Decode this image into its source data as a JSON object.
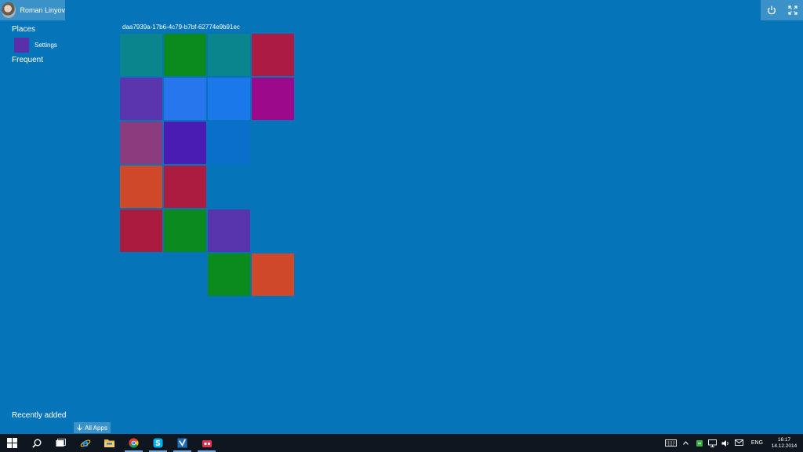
{
  "user": {
    "name": "Roman Linyov"
  },
  "left_pane": {
    "places_heading": "Places",
    "places": [
      {
        "label": "Settings",
        "color": "#5c2faa"
      }
    ],
    "frequent_heading": "Frequent",
    "recently_added_heading": "Recently added",
    "all_apps_label": "All Apps"
  },
  "top_right": {
    "buttons": [
      "power-icon",
      "fullscreen-icon"
    ]
  },
  "tile_group": {
    "title": "daa7939a-17b6-4c79-b7bf-62774e9b91ec",
    "tiles": [
      {
        "row": 0,
        "col": 0,
        "color": "#0a858e"
      },
      {
        "row": 0,
        "col": 1,
        "color": "#0b8a1e"
      },
      {
        "row": 0,
        "col": 2,
        "color": "#0a858e"
      },
      {
        "row": 0,
        "col": 3,
        "color": "#ab1b43"
      },
      {
        "row": 1,
        "col": 0,
        "color": "#5a35ad"
      },
      {
        "row": 1,
        "col": 1,
        "color": "#2776ed"
      },
      {
        "row": 1,
        "col": 2,
        "color": "#1a78ea"
      },
      {
        "row": 1,
        "col": 3,
        "color": "#9c0a8b"
      },
      {
        "row": 2,
        "col": 0,
        "color": "#8c3b7f"
      },
      {
        "row": 2,
        "col": 1,
        "color": "#4a1cb3"
      },
      {
        "row": 2,
        "col": 2,
        "color": "#0a6fcb"
      },
      {
        "row": 3,
        "col": 0,
        "color": "#d0482a"
      },
      {
        "row": 3,
        "col": 1,
        "color": "#ac1b40"
      },
      {
        "row": 4,
        "col": 0,
        "color": "#ab1b40"
      },
      {
        "row": 4,
        "col": 1,
        "color": "#0a8a1f"
      },
      {
        "row": 4,
        "col": 2,
        "color": "#5835ad"
      },
      {
        "row": 5,
        "col": 2,
        "color": "#0b8a1e"
      },
      {
        "row": 5,
        "col": 3,
        "color": "#d0482a"
      }
    ]
  },
  "taskbar": {
    "buttons": [
      {
        "name": "start-icon",
        "running": false
      },
      {
        "name": "search-icon",
        "running": false
      },
      {
        "name": "task-view-icon",
        "running": false
      },
      {
        "name": "internet-explorer-icon",
        "running": false
      },
      {
        "name": "file-explorer-icon",
        "running": false
      },
      {
        "name": "chrome-icon",
        "running": true
      },
      {
        "name": "skype-icon",
        "running": true
      },
      {
        "name": "visual-studio-icon",
        "running": true
      },
      {
        "name": "app-icon",
        "running": true
      }
    ],
    "tray": {
      "language": "ENG",
      "time": "16:17",
      "date": "14.12.2014"
    }
  },
  "colors": {
    "background": "#0674b8",
    "accent_light": "#3b92c9",
    "taskbar": "#10161f"
  }
}
